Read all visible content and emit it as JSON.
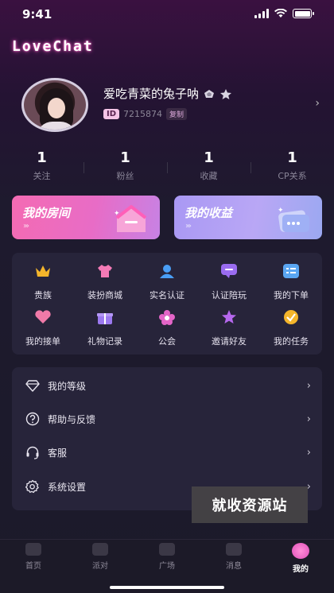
{
  "status_bar": {
    "time": "9:41"
  },
  "brand": "LoveChat",
  "profile": {
    "nickname": "爱吃青菜的兔子呐",
    "id_tag": "ID",
    "id_number": "7215874",
    "copy_label": "复制"
  },
  "stats": [
    {
      "value": "1",
      "label": "关注"
    },
    {
      "value": "1",
      "label": "粉丝"
    },
    {
      "value": "1",
      "label": "收藏"
    },
    {
      "value": "1",
      "label": "CP关系"
    }
  ],
  "cards": {
    "room": "我的房间",
    "income": "我的收益"
  },
  "grid": {
    "row1": [
      {
        "label": "贵族",
        "icon": "crown-icon",
        "color": "#f4b52b"
      },
      {
        "label": "装扮商城",
        "icon": "shirt-icon",
        "color": "#f47ab6"
      },
      {
        "label": "实名认证",
        "icon": "user-verify-icon",
        "color": "#4a9ef5"
      },
      {
        "label": "认证陪玩",
        "icon": "chat-bubble-icon",
        "color": "#9a6cf0"
      },
      {
        "label": "我的下单",
        "icon": "list-icon",
        "color": "#5aa6f2"
      }
    ],
    "row2": [
      {
        "label": "我的接单",
        "icon": "heart-icon",
        "color": "#f07aa8"
      },
      {
        "label": "礼物记录",
        "icon": "gift-icon",
        "color": "#9c79f0"
      },
      {
        "label": "公会",
        "icon": "flower-icon",
        "color": "#e465c8"
      },
      {
        "label": "邀请好友",
        "icon": "invite-icon",
        "color": "#b668ee"
      },
      {
        "label": "我的任务",
        "icon": "task-icon",
        "color": "#f4b52b"
      }
    ]
  },
  "menu": [
    {
      "label": "我的等级",
      "icon": "diamond-icon"
    },
    {
      "label": "帮助与反馈",
      "icon": "help-icon"
    },
    {
      "label": "客服",
      "icon": "headset-icon"
    },
    {
      "label": "系统设置",
      "icon": "gear-icon"
    }
  ],
  "watermark": "就收资源站",
  "tabbar": [
    {
      "label": "首页",
      "icon": "home-icon",
      "active": false
    },
    {
      "label": "派对",
      "icon": "party-icon",
      "active": false
    },
    {
      "label": "广场",
      "icon": "square-icon",
      "active": false
    },
    {
      "label": "消息",
      "icon": "message-icon",
      "active": false
    },
    {
      "label": "我的",
      "icon": "profile-icon",
      "active": true
    }
  ]
}
